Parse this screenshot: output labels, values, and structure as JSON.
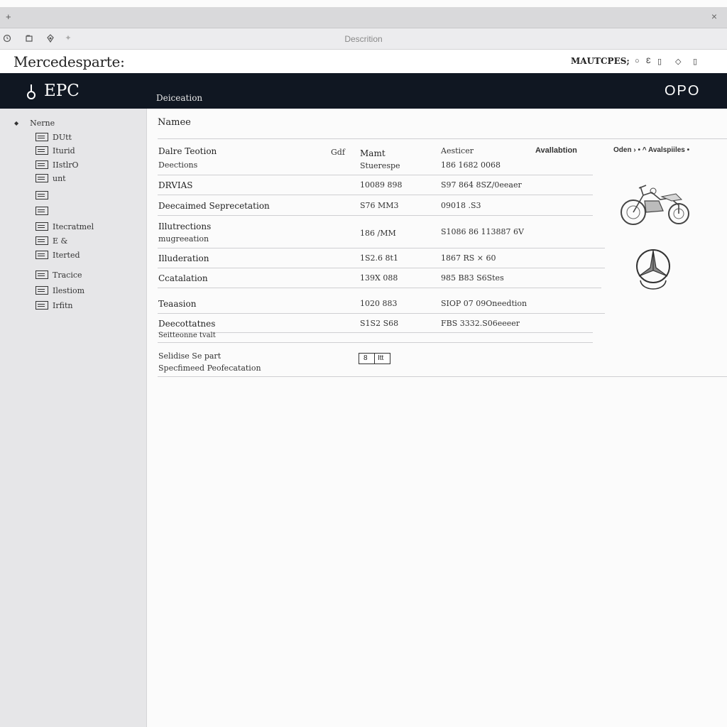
{
  "window": {
    "new_tab_glyph": "+",
    "close_glyph": "×",
    "address_text": "Descrition"
  },
  "toolbar_icons": [
    "back-icon",
    "home-icon",
    "shield-icon",
    "star-icon"
  ],
  "brand": {
    "logo_text": "Mercedesparte:",
    "account_text": "MAUTCPES;",
    "icons": [
      "circle-icon",
      "e-icon",
      "grid-icon",
      "bell-icon",
      "trash-icon"
    ]
  },
  "header": {
    "app_name": "EPC",
    "section_label": "Deiceation",
    "right_label": "OPO"
  },
  "sidebar": {
    "root_label": "Nerne",
    "items": [
      {
        "label": "DUtt"
      },
      {
        "label": "Iturid"
      },
      {
        "label": "IIstlrO"
      },
      {
        "label": "unt"
      },
      {
        "label": ""
      },
      {
        "label": ""
      },
      {
        "label": "Itecratmel"
      },
      {
        "label": "E &"
      },
      {
        "label": "Iterted"
      },
      {
        "label": "Tracice"
      },
      {
        "label": "Ilestiom"
      },
      {
        "label": "Irfitn"
      }
    ]
  },
  "main": {
    "title": "Namee",
    "columns": {
      "col1": "Dalre Teotion",
      "col1_sub": "Deections",
      "col2": "Gdf",
      "col3": "Mamt",
      "col3_sub": "Stuerespe",
      "col4": "Aesticer",
      "col4_sub": "186  1682 0068",
      "col5": "Avallabtion",
      "col6": "Oden › • ^ Avalspiiles •"
    },
    "rows": [
      {
        "name": "DRVIAS",
        "part": "10089 898",
        "avail": "S97 864 8SZ/0eeaer"
      },
      {
        "name": "Deecaimed Seprecetation",
        "part": "S76 MM3",
        "avail": "09018 .S3"
      },
      {
        "name": "Illutrections",
        "name2": "mugreeation",
        "part": "186 /MM",
        "avail": "S1086 86 113887 6V"
      },
      {
        "name": "Illuderation",
        "part": "1S2.6 8t1",
        "avail": "1867 RS  ×  60"
      },
      {
        "name": "Ccatalation",
        "part": "139X 088",
        "avail": "985 B83 S6Stes"
      },
      {
        "name": "Teaasion",
        "part": "1020 883",
        "avail": "SIOP 07 09Oneedtion"
      },
      {
        "name": "Deecottatnes",
        "part": "S1S2 S68",
        "avail": "FBS 3332.S06eeeer"
      }
    ],
    "row7_sub": "Seitteonne tvalt",
    "footer_line1": "Selidise Se part",
    "footer_line2": "Specfimeed Peofecatation",
    "qty_left": "8",
    "qty_right": "Itt"
  }
}
